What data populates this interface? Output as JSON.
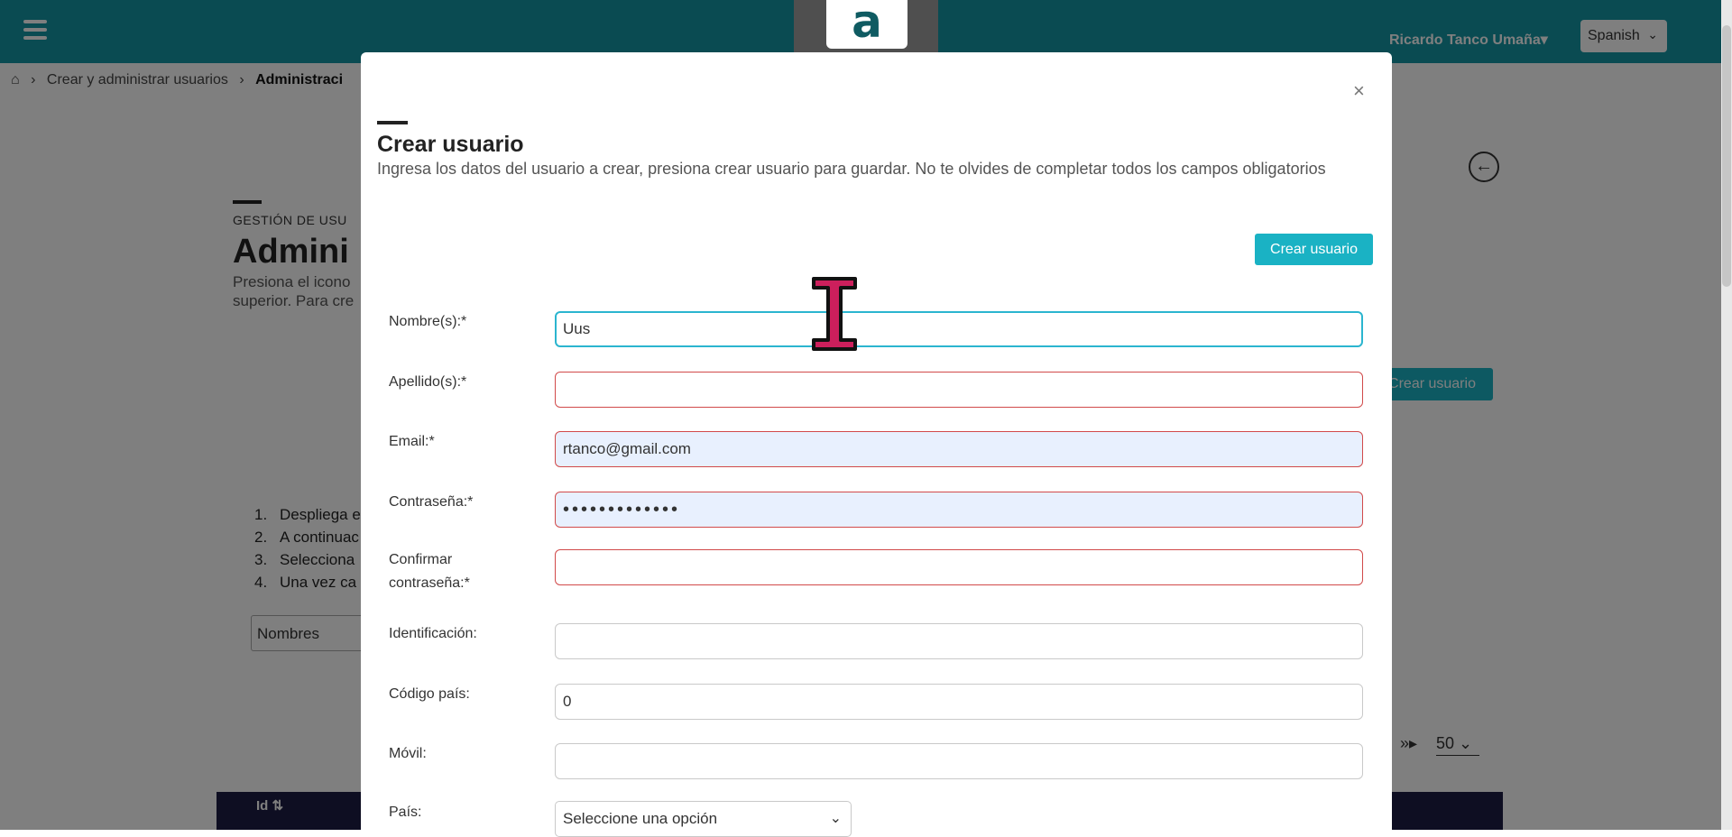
{
  "topbar": {
    "user_name": "Ricardo Tanco Umaña▾",
    "language": "Spanish",
    "language_chevron": "⌄"
  },
  "breadcrumb": {
    "home_icon": "⌂",
    "items": [
      "Crear y administrar usuarios",
      "Administraci"
    ]
  },
  "background_page": {
    "section_label": "GESTIÓN DE USU",
    "title": "Admini",
    "description_line1": "Presiona el icono",
    "description_line2": "superior. Para cre",
    "create_button": "Crear usuario",
    "steps": [
      {
        "n": "1.",
        "text": "Despliega e"
      },
      {
        "n": "2.",
        "text": "A continuac"
      },
      {
        "n": "3.",
        "text": "Selecciona"
      },
      {
        "n": "4.",
        "text": "Una vez ca"
      }
    ],
    "filter_value": "Nombres",
    "paging_arrows": "»▸",
    "per_page": "50 ⌄",
    "table_first_col": "Id ⇅"
  },
  "logo": {
    "letter": "a"
  },
  "modal": {
    "close": "×",
    "title": "Crear usuario",
    "description": "Ingresa los datos del usuario a crear, presiona crear usuario para guardar. No te olvides de completar todos los campos obligatorios",
    "create_button": "Crear usuario",
    "fields": {
      "nombres": {
        "label": "Nombre(s):*",
        "value": "Uus"
      },
      "apellidos": {
        "label": "Apellido(s):*",
        "value": ""
      },
      "email": {
        "label": "Email:*",
        "value": "rtanco@gmail.com"
      },
      "contrasena": {
        "label": "Contraseña:*",
        "value": "•••••••••••••"
      },
      "confirmar_line1": "Confirmar",
      "confirmar_line2": "contraseña:*",
      "confirmar_value": "",
      "identificacion": {
        "label": "Identificación:",
        "value": ""
      },
      "codigo_pais": {
        "label": "Código país:",
        "value": "0"
      },
      "movil": {
        "label": "Móvil:",
        "value": ""
      },
      "pais": {
        "label": "País:",
        "value": "Seleccione una opción"
      }
    }
  },
  "colors": {
    "topbar": "#1597a4",
    "accent_button": "#1ab2c4",
    "error_border": "#d14a4a",
    "focus_border": "#2bb5cf",
    "cursor": "#cc1f5c"
  }
}
